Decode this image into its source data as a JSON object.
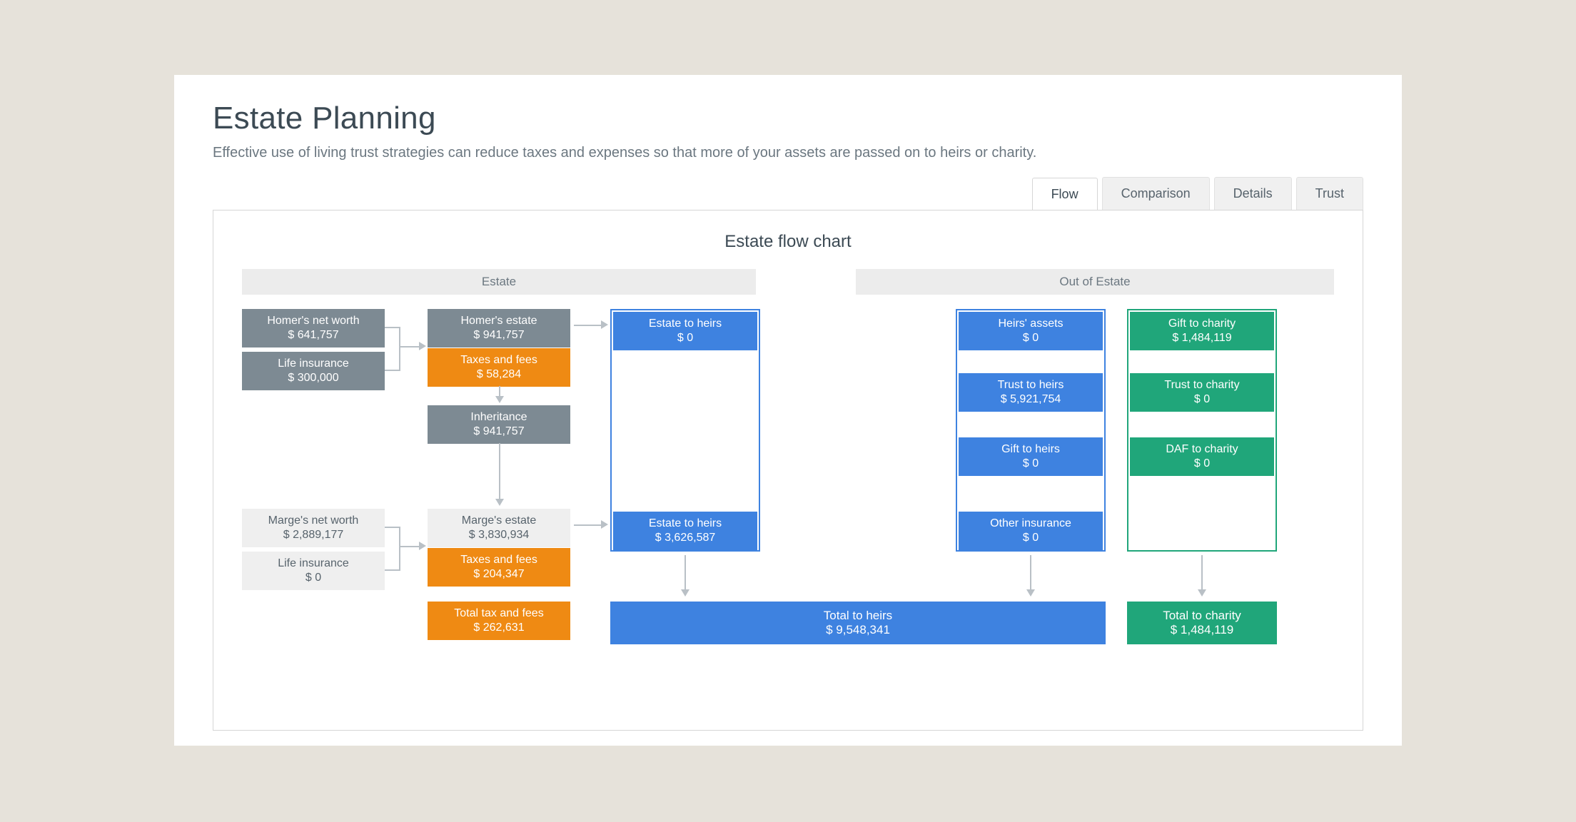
{
  "page": {
    "title": "Estate Planning",
    "subtitle": "Effective use of living trust strategies can reduce taxes and expenses so that more of your assets are passed on to heirs or charity."
  },
  "tabs": {
    "flow": "Flow",
    "comparison": "Comparison",
    "details": "Details",
    "trust": "Trust"
  },
  "chart": {
    "title": "Estate flow chart",
    "section_estate": "Estate",
    "section_out": "Out of Estate"
  },
  "estate": {
    "homer_networth": {
      "label": "Homer's net worth",
      "value": "$ 641,757"
    },
    "homer_life": {
      "label": "Life insurance",
      "value": "$ 300,000"
    },
    "homer_estate": {
      "label": "Homer's estate",
      "value": "$ 941,757"
    },
    "homer_taxes": {
      "label": "Taxes and fees",
      "value": "$ 58,284"
    },
    "inheritance": {
      "label": "Inheritance",
      "value": "$ 941,757"
    },
    "marge_networth": {
      "label": "Marge's net worth",
      "value": "$ 2,889,177"
    },
    "marge_life": {
      "label": "Life insurance",
      "value": "$ 0"
    },
    "marge_estate": {
      "label": "Marge's estate",
      "value": "$ 3,830,934"
    },
    "marge_taxes": {
      "label": "Taxes and fees",
      "value": "$ 204,347"
    },
    "total_tax": {
      "label": "Total tax and fees",
      "value": "$ 262,631"
    },
    "estate_heirs_1": {
      "label": "Estate to heirs",
      "value": "$ 0"
    },
    "estate_heirs_2": {
      "label": "Estate to heirs",
      "value": "$ 3,626,587"
    }
  },
  "out": {
    "heirs_assets": {
      "label": "Heirs' assets",
      "value": "$ 0"
    },
    "trust_heirs": {
      "label": "Trust to heirs",
      "value": "$ 5,921,754"
    },
    "gift_heirs": {
      "label": "Gift to heirs",
      "value": "$ 0"
    },
    "other_ins": {
      "label": "Other insurance",
      "value": "$ 0"
    },
    "gift_charity": {
      "label": "Gift to charity",
      "value": "$ 1,484,119"
    },
    "trust_charity": {
      "label": "Trust to charity",
      "value": "$ 0"
    },
    "daf_charity": {
      "label": "DAF to charity",
      "value": "$ 0"
    }
  },
  "totals": {
    "heirs": {
      "label": "Total to heirs",
      "value": "$ 9,548,341"
    },
    "charity": {
      "label": "Total to charity",
      "value": "$ 1,484,119"
    }
  },
  "chart_data": {
    "type": "flow",
    "title": "Estate flow chart",
    "sections": [
      "Estate",
      "Out of Estate"
    ],
    "nodes": [
      {
        "id": "homer_networth",
        "section": "Estate",
        "color": "gray",
        "label": "Homer's net worth",
        "value": 641757
      },
      {
        "id": "homer_life",
        "section": "Estate",
        "color": "gray",
        "label": "Life insurance",
        "value": 300000
      },
      {
        "id": "homer_estate",
        "section": "Estate",
        "color": "gray",
        "label": "Homer's estate",
        "value": 941757
      },
      {
        "id": "homer_taxes",
        "section": "Estate",
        "color": "orange",
        "label": "Taxes and fees",
        "value": 58284
      },
      {
        "id": "inheritance",
        "section": "Estate",
        "color": "gray",
        "label": "Inheritance",
        "value": 941757
      },
      {
        "id": "marge_networth",
        "section": "Estate",
        "color": "light",
        "label": "Marge's net worth",
        "value": 2889177
      },
      {
        "id": "marge_life",
        "section": "Estate",
        "color": "light",
        "label": "Life insurance",
        "value": 0
      },
      {
        "id": "marge_estate",
        "section": "Estate",
        "color": "light",
        "label": "Marge's estate",
        "value": 3830934
      },
      {
        "id": "marge_taxes",
        "section": "Estate",
        "color": "orange",
        "label": "Taxes and fees",
        "value": 204347
      },
      {
        "id": "total_tax",
        "section": "Estate",
        "color": "orange",
        "label": "Total tax and fees",
        "value": 262631
      },
      {
        "id": "estate_heirs_1",
        "section": "Estate",
        "color": "blue",
        "label": "Estate to heirs",
        "value": 0
      },
      {
        "id": "estate_heirs_2",
        "section": "Estate",
        "color": "blue",
        "label": "Estate to heirs",
        "value": 3626587
      },
      {
        "id": "heirs_assets",
        "section": "Out of Estate",
        "color": "blue",
        "label": "Heirs' assets",
        "value": 0
      },
      {
        "id": "trust_heirs",
        "section": "Out of Estate",
        "color": "blue",
        "label": "Trust to heirs",
        "value": 5921754
      },
      {
        "id": "gift_heirs",
        "section": "Out of Estate",
        "color": "blue",
        "label": "Gift to heirs",
        "value": 0
      },
      {
        "id": "other_ins",
        "section": "Out of Estate",
        "color": "blue",
        "label": "Other insurance",
        "value": 0
      },
      {
        "id": "gift_charity",
        "section": "Out of Estate",
        "color": "green",
        "label": "Gift to charity",
        "value": 1484119
      },
      {
        "id": "trust_charity",
        "section": "Out of Estate",
        "color": "green",
        "label": "Trust to charity",
        "value": 0
      },
      {
        "id": "daf_charity",
        "section": "Out of Estate",
        "color": "green",
        "label": "DAF to charity",
        "value": 0
      }
    ],
    "totals": [
      {
        "id": "total_heirs",
        "color": "blue",
        "label": "Total to heirs",
        "value": 9548341
      },
      {
        "id": "total_charity",
        "color": "green",
        "label": "Total to charity",
        "value": 1484119
      }
    ],
    "edges": [
      [
        "homer_networth",
        "homer_estate"
      ],
      [
        "homer_life",
        "homer_estate"
      ],
      [
        "homer_estate",
        "homer_taxes"
      ],
      [
        "homer_estate",
        "estate_heirs_1"
      ],
      [
        "homer_taxes",
        "inheritance"
      ],
      [
        "inheritance",
        "marge_estate"
      ],
      [
        "marge_networth",
        "marge_estate"
      ],
      [
        "marge_life",
        "marge_estate"
      ],
      [
        "marge_estate",
        "marge_taxes"
      ],
      [
        "marge_estate",
        "estate_heirs_2"
      ],
      [
        "estate_heirs_2",
        "total_heirs"
      ],
      [
        "heirs_assets",
        "total_heirs"
      ],
      [
        "trust_heirs",
        "total_heirs"
      ],
      [
        "gift_heirs",
        "total_heirs"
      ],
      [
        "other_ins",
        "total_heirs"
      ],
      [
        "gift_charity",
        "total_charity"
      ],
      [
        "trust_charity",
        "total_charity"
      ],
      [
        "daf_charity",
        "total_charity"
      ]
    ]
  }
}
